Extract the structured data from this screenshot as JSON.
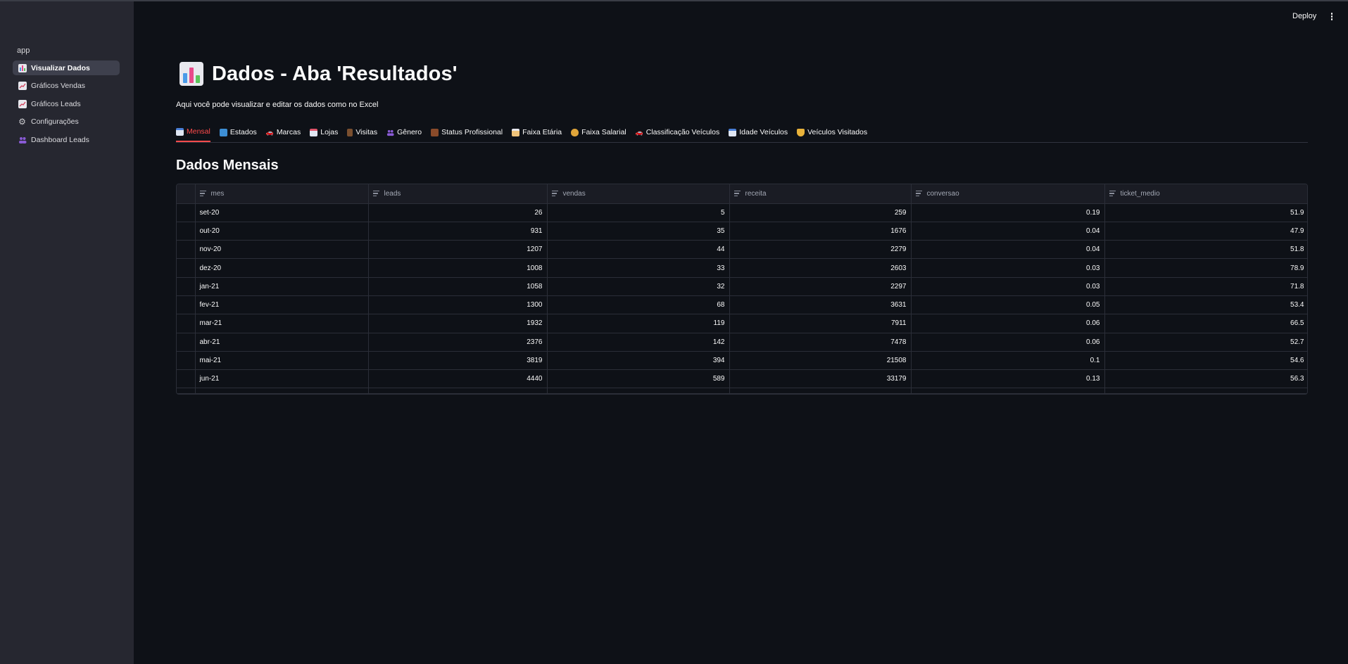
{
  "sidebar": {
    "app_label": "app",
    "items": [
      {
        "label": "Visualizar Dados",
        "icon": "bar-chart-icon",
        "active": true
      },
      {
        "label": "Gráficos Vendas",
        "icon": "chart-increasing-icon",
        "active": false
      },
      {
        "label": "Gráficos Leads",
        "icon": "chart-increasing-icon",
        "active": false
      },
      {
        "label": "Configurações",
        "icon": "gear-icon",
        "active": false
      },
      {
        "label": "Dashboard Leads",
        "icon": "people-icon",
        "active": false
      }
    ]
  },
  "header": {
    "deploy_label": "Deploy",
    "menu_icon": "kebab-menu-icon"
  },
  "main": {
    "title": "Dados - Aba 'Resultados'",
    "title_icon": "bar-chart-icon",
    "subtitle": "Aqui você pode visualizar e editar os dados como no Excel",
    "section_title": "Dados Mensais",
    "tabs": [
      {
        "label": "Mensal",
        "icon": "calendar-icon",
        "active": true
      },
      {
        "label": "Estados",
        "icon": "map-icon",
        "active": false
      },
      {
        "label": "Marcas",
        "icon": "car-icon",
        "active": false
      },
      {
        "label": "Lojas",
        "icon": "store-icon",
        "active": false
      },
      {
        "label": "Visitas",
        "icon": "door-icon",
        "active": false
      },
      {
        "label": "Gênero",
        "icon": "people-icon",
        "active": false
      },
      {
        "label": "Status Profissional",
        "icon": "briefcase-icon",
        "active": false
      },
      {
        "label": "Faixa Etária",
        "icon": "cake-icon",
        "active": false
      },
      {
        "label": "Faixa Salarial",
        "icon": "money-bag-icon",
        "active": false
      },
      {
        "label": "Classificação Veículos",
        "icon": "car-icon",
        "active": false
      },
      {
        "label": "Idade Veículos",
        "icon": "calendar-icon",
        "active": false
      },
      {
        "label": "Veículos Visitados",
        "icon": "trophy-icon",
        "active": false
      }
    ]
  },
  "table": {
    "columns": [
      "mes",
      "leads",
      "vendas",
      "receita",
      "conversao",
      "ticket_medio"
    ],
    "rows": [
      [
        "set-20",
        "26",
        "5",
        "259",
        "0.19",
        "51.9"
      ],
      [
        "out-20",
        "931",
        "35",
        "1676",
        "0.04",
        "47.9"
      ],
      [
        "nov-20",
        "1207",
        "44",
        "2279",
        "0.04",
        "51.8"
      ],
      [
        "dez-20",
        "1008",
        "33",
        "2603",
        "0.03",
        "78.9"
      ],
      [
        "jan-21",
        "1058",
        "32",
        "2297",
        "0.03",
        "71.8"
      ],
      [
        "fev-21",
        "1300",
        "68",
        "3631",
        "0.05",
        "53.4"
      ],
      [
        "mar-21",
        "1932",
        "119",
        "7911",
        "0.06",
        "66.5"
      ],
      [
        "abr-21",
        "2376",
        "142",
        "7478",
        "0.06",
        "52.7"
      ],
      [
        "mai-21",
        "3819",
        "394",
        "21508",
        "0.1",
        "54.6"
      ],
      [
        "jun-21",
        "4440",
        "589",
        "33179",
        "0.13",
        "56.3"
      ]
    ]
  },
  "colors": {
    "background": "#0e1117",
    "sidebar": "#262730",
    "accent": "#ff4b4b"
  }
}
